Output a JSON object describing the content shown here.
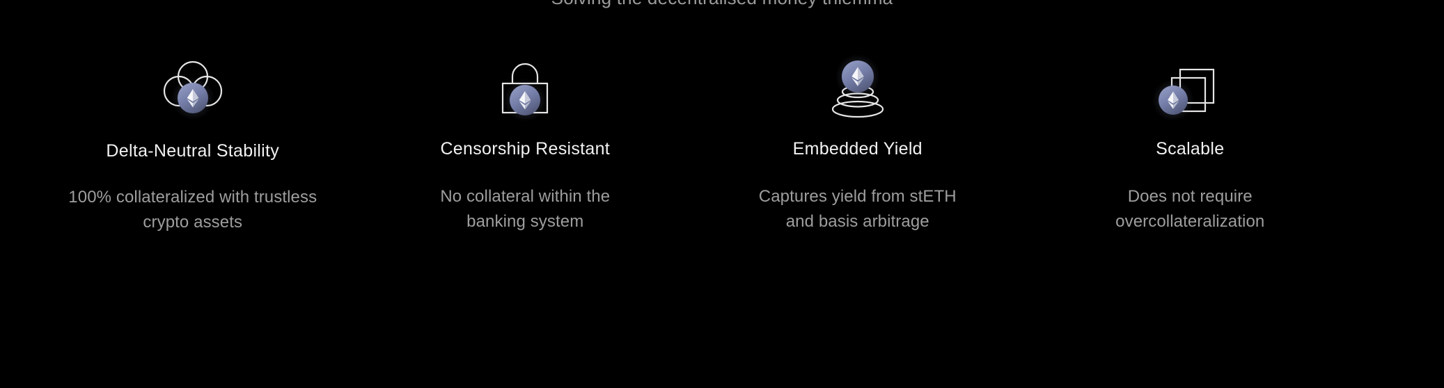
{
  "section": {
    "subtitle": "Solving the decentralised money trilemma"
  },
  "colors": {
    "background": "#000000",
    "title_text": "#f2f2f2",
    "body_text": "#9e9e9e",
    "subtitle_text": "#9b9b9b",
    "icon_stroke": "#e8e8e8",
    "badge_fill_light": "#8e97bf",
    "badge_fill_dark": "#5c6488",
    "eth_light": "#ffffff",
    "eth_mid": "#cfd3e0",
    "eth_dark": "#9aa0b8"
  },
  "features": [
    {
      "icon": "cloud-eth-icon",
      "title": "Delta-Neutral Stability",
      "desc_line1": "100% collateralized with trustless",
      "desc_line2": "crypto assets"
    },
    {
      "icon": "padlock-eth-icon",
      "title": "Censorship Resistant",
      "desc_line1": "No collateral within the",
      "desc_line2": "banking system"
    },
    {
      "icon": "stacked-rings-eth-icon",
      "title": "Embedded Yield",
      "desc_line1": "Captures yield from stETH",
      "desc_line2": "and basis arbitrage"
    },
    {
      "icon": "nested-squares-eth-icon",
      "title": "Scalable",
      "desc_line1": "Does not require",
      "desc_line2": "overcollateralization"
    }
  ]
}
